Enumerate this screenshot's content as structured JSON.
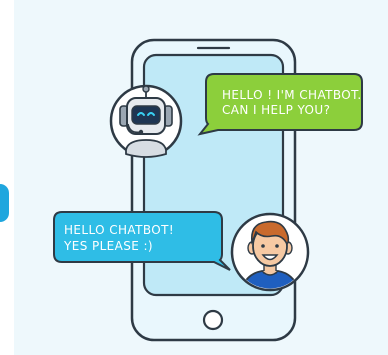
{
  "bot_message": {
    "line1": "HELLO ! I'M CHATBOT.",
    "line2": "CAN I HELP YOU?"
  },
  "user_message": {
    "line1": "HELLO CHATBOT!",
    "line2": "YES PLEASE :)"
  },
  "colors": {
    "background": "#eef8fc",
    "phone_body": "#e9f7fd",
    "phone_screen": "#bfe9f7",
    "outline": "#2e3a45",
    "bot_bubble": "#8ccf3b",
    "user_bubble": "#2fbde6",
    "avatar_bg": "#ffffff",
    "user_shirt": "#1f5fbf",
    "user_hair": "#c96a2d",
    "bot_face": "#1e3552",
    "bot_eyes": "#39d0f2"
  },
  "icons": {
    "bot": "robot-avatar-icon",
    "user": "user-avatar-icon",
    "home": "home-button-icon"
  }
}
